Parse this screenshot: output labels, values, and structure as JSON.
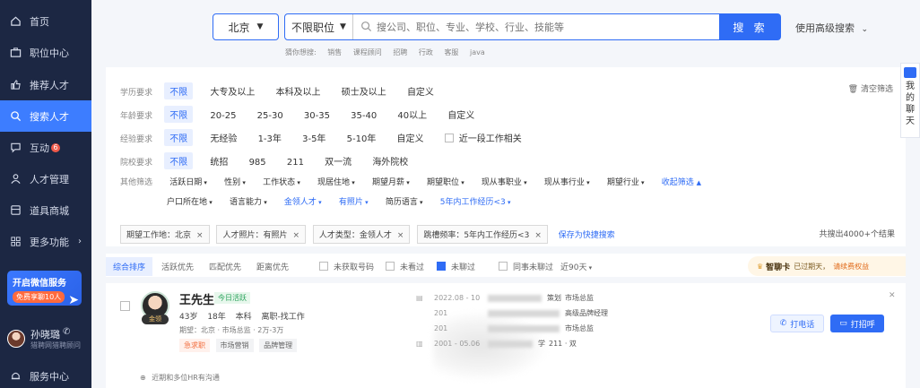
{
  "sidebar": {
    "items": [
      {
        "label": "首页",
        "icon": "home-icon"
      },
      {
        "label": "职位中心",
        "icon": "briefcase-icon"
      },
      {
        "label": "推荐人才",
        "icon": "thumbs-up-icon"
      },
      {
        "label": "搜索人才",
        "icon": "search-icon"
      },
      {
        "label": "互动",
        "icon": "chat-icon",
        "badge": "6"
      },
      {
        "label": "人才管理",
        "icon": "person-icon"
      },
      {
        "label": "道具商城",
        "icon": "shop-icon"
      },
      {
        "label": "更多功能",
        "icon": "grid-icon"
      }
    ],
    "promo": {
      "title": "开启微信服务",
      "sub": "免费享聊10人"
    },
    "user": {
      "name": "孙晓璐",
      "sub": "猎聘网猎聘顾问"
    },
    "service": "服务中心"
  },
  "search": {
    "city": "北京",
    "position": "不限职位",
    "placeholder": "搜公司、职位、专业、学校、行业、技能等",
    "button": "搜 索",
    "advanced": "使用高级搜索",
    "hot_label": "猜你想搜:",
    "hot_words": [
      "销售",
      "课程顾问",
      "招聘",
      "行政",
      "客服",
      "java"
    ]
  },
  "filters": {
    "education": {
      "label": "学历要求",
      "options": [
        "不限",
        "大专及以上",
        "本科及以上",
        "硕士及以上",
        "自定义"
      ]
    },
    "age": {
      "label": "年龄要求",
      "options": [
        "不限",
        "20-25",
        "25-30",
        "30-35",
        "35-40",
        "40以上",
        "自定义"
      ]
    },
    "experience": {
      "label": "经验要求",
      "options": [
        "不限",
        "无经验",
        "1-3年",
        "3-5年",
        "5-10年",
        "自定义"
      ],
      "extra": "近一段工作相关"
    },
    "school": {
      "label": "院校要求",
      "options": [
        "不限",
        "统招",
        "985",
        "211",
        "双一流",
        "海外院校"
      ]
    },
    "other": {
      "label": "其他筛选",
      "row1": [
        "活跃日期",
        "性别",
        "工作状态",
        "现居住地",
        "期望月薪",
        "期望职位",
        "现从事职业",
        "现从事行业",
        "期望行业"
      ],
      "collapse": "收起筛选",
      "row2": [
        "户口所在地",
        "语言能力",
        "金领人才",
        "有照片",
        "简历语言",
        "5年内工作经历<3"
      ]
    },
    "clear": "清空筛选",
    "tags": [
      "期望工作地：北京",
      "人才照片：有照片",
      "人才类型：金领人才",
      "跳槽频率：5年内工作经历<3"
    ],
    "save_shortcut": "保存为快捷搜索",
    "total": "共搜出4000+个结果"
  },
  "sort": {
    "options": [
      "综合排序",
      "活跃优先",
      "匹配优先",
      "距离优先"
    ],
    "checks": [
      {
        "label": "未获取号码",
        "checked": false
      },
      {
        "label": "未看过",
        "checked": false
      },
      {
        "label": "未聊过",
        "checked": true
      },
      {
        "label": "同事未聊过",
        "checked": false
      }
    ],
    "range": "近90天",
    "vip": {
      "title": "智聊卡",
      "text": "已过期天，",
      "warn": "请续费权益"
    }
  },
  "candidate": {
    "name": "王先生",
    "active": "今日活跃",
    "gold": "金领",
    "basic": [
      "43岁",
      "18年",
      "本科",
      "离职-找工作"
    ],
    "expect": "期望：北京 · 市场总监 · 2万-3万",
    "tags": [
      "急求职",
      "市场营销",
      "品牌管理"
    ],
    "experience": [
      {
        "date": "2022.08 - 10",
        "pos": "市场总监",
        "tail": "策划"
      },
      {
        "date": "201",
        "pos": "高级品牌经理",
        "tail": ""
      },
      {
        "date": "201",
        "pos": "市场总监",
        "tail": ""
      },
      {
        "date": "2001 - 05.06",
        "pos": "211 · 双",
        "tail": "学"
      }
    ],
    "call": "打电话",
    "greet": "打招呼",
    "footer": "近期和多位HR有沟通"
  },
  "float_chat": {
    "label": [
      "我",
      "的",
      "聊",
      "天"
    ]
  }
}
